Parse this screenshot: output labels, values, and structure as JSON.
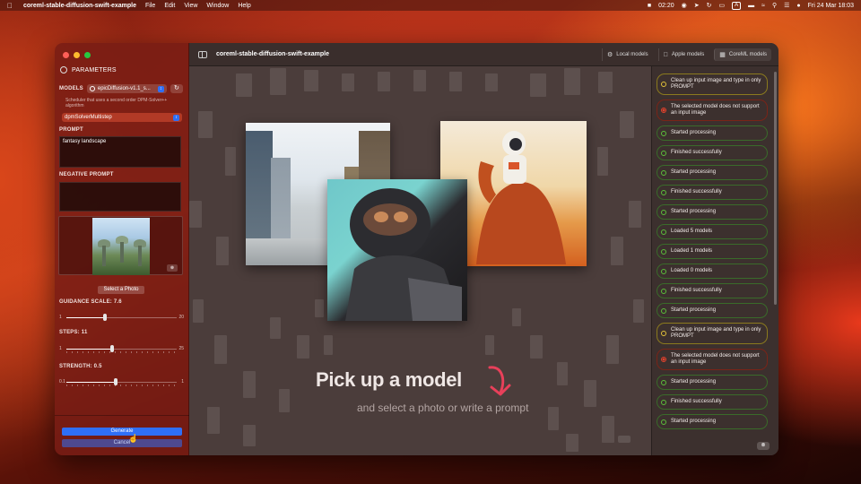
{
  "menubar": {
    "apple_icon": "apple-icon",
    "app_name": "coreml-stable-diffusion-swift-example",
    "menus": [
      "File",
      "Edit",
      "View",
      "Window",
      "Help"
    ],
    "time_badge": "02:20",
    "datetime": "Fri 24 Mar  18:03",
    "input_source": "A"
  },
  "sidebar": {
    "header": "PARAMETERS",
    "models_label": "MODELS",
    "model_selected": "epicDiffusion-v1.1_s...",
    "scheduler_hint": "Scheduler that uses a second order DPM-Solver++ algorithm",
    "scheduler_selected": "dpmSolverMultistep",
    "prompt_label": "PROMPT",
    "prompt_value": "fantasy landscape",
    "negative_prompt_label": "NEGATIVE PROMPT",
    "negative_prompt_value": "",
    "select_photo": "Select a Photo",
    "guidance_label": "GUIDANCE SCALE: 7.6",
    "guidance": {
      "min": "1",
      "max": "20",
      "value": 7.6
    },
    "steps_label": "STEPS: 11",
    "steps": {
      "min": "1",
      "max": "25",
      "value": 11
    },
    "strength_label": "STRENGTH: 0.5",
    "strength": {
      "min": "0.1",
      "max": "1",
      "value": 0.5
    },
    "generate": "Generate",
    "cancel": "Cancel"
  },
  "toolbar": {
    "title": "coreml-stable-diffusion-swift-example",
    "tabs": [
      {
        "label": "Local models",
        "icon": "gear-icon"
      },
      {
        "label": "Apple models",
        "icon": "apple-icon"
      },
      {
        "label": "CoreML models",
        "icon": "grid-icon"
      }
    ]
  },
  "stage": {
    "title": "Pick up a model",
    "subtitle": "and select a photo or write a prompt"
  },
  "log": [
    {
      "text": "Clean up input image and type in only PROMPT",
      "status": "warn"
    },
    {
      "text": "The selected model does not support an input image",
      "status": "err"
    },
    {
      "text": "Started processing",
      "status": "ok"
    },
    {
      "text": "Finished successfully",
      "status": "ok"
    },
    {
      "text": "Started processing",
      "status": "ok"
    },
    {
      "text": "Finished successfully",
      "status": "ok"
    },
    {
      "text": "Started processing",
      "status": "ok"
    },
    {
      "text": "Loaded 5 models",
      "status": "ok"
    },
    {
      "text": "Loaded 1 models",
      "status": "ok"
    },
    {
      "text": "Loaded 0 models",
      "status": "ok"
    },
    {
      "text": "Finished successfully",
      "status": "ok"
    },
    {
      "text": "Started processing",
      "status": "ok"
    },
    {
      "text": "Clean up input image and type in only PROMPT",
      "status": "warn"
    },
    {
      "text": "The selected model does not support an input image",
      "status": "err"
    },
    {
      "text": "Started processing",
      "status": "ok"
    },
    {
      "text": "Finished successfully",
      "status": "ok"
    },
    {
      "text": "Started processing",
      "status": "ok"
    }
  ],
  "colors": {
    "accent": "#2f6ff6",
    "ok": "#5bbf3a",
    "warn": "#e2c23a",
    "err": "#e2412c",
    "arrow": "#e8405a"
  }
}
